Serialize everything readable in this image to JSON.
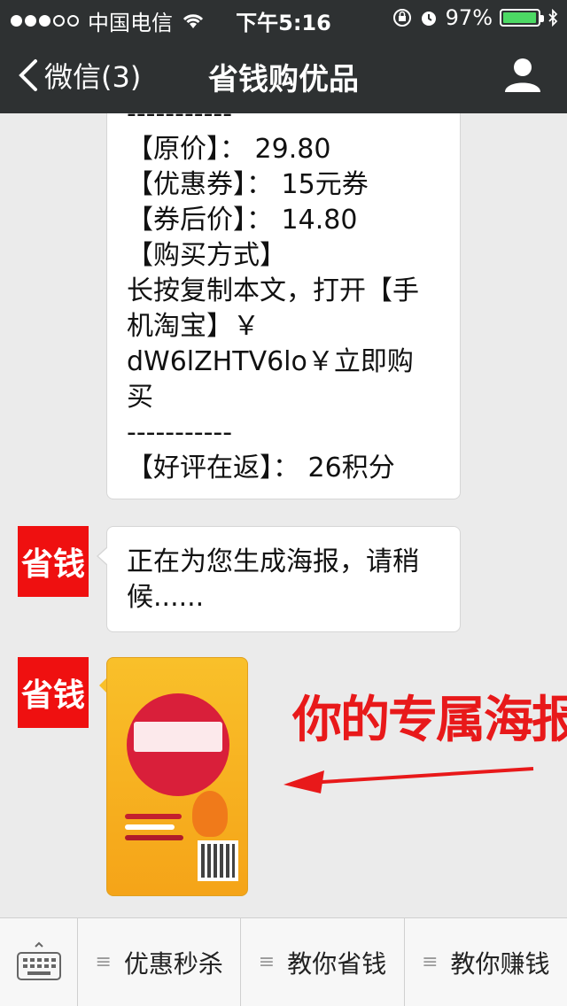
{
  "status_bar": {
    "carrier": "中国电信",
    "time": "下午5:16",
    "battery": "97%",
    "battery_level": 0.97
  },
  "nav": {
    "back_label": "微信(3)",
    "title": "省钱购优品"
  },
  "messages": {
    "product_lines": [
      "-----------",
      "【原价】： 29.80",
      "【优惠券】： 15元券",
      "【券后价】： 14.80",
      "【购买方式】",
      "长按复制本文，打开【手",
      "机淘宝】￥",
      "dW6lZHTV6lo￥立即购",
      "买",
      "-----------",
      "【好评在返】： 26积分"
    ],
    "generating_text": "正在为您生成海报，请稍候......",
    "avatar_label": "省钱",
    "annotation": "你的专属海报"
  },
  "bottom_bar": {
    "menus": [
      "优惠秒杀",
      "教你省钱",
      "教你赚钱"
    ]
  },
  "colors": {
    "nav_bg": "#2e3132",
    "avatar_bg": "#ef1010",
    "annotation": "#e8191a",
    "poster": "#f9c02a"
  }
}
